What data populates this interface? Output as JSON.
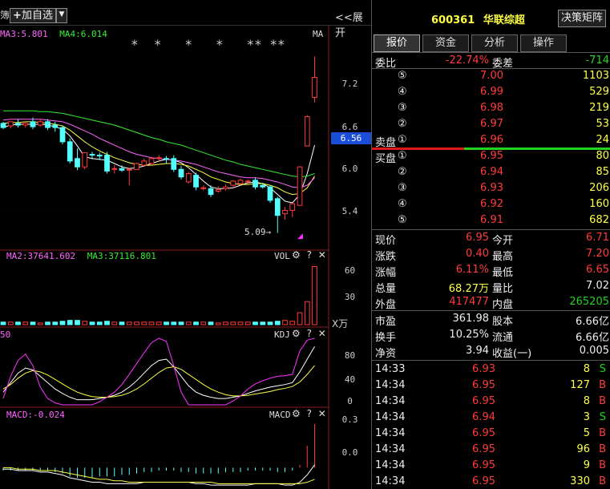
{
  "toolbar": {
    "left_cut": "簿",
    "add_label": "加自选",
    "expand_label": "展开",
    "expand_arrows": "<<"
  },
  "main_chart": {
    "ma_labels": [
      {
        "text": "MA3:5.801",
        "color": "#ff66ff"
      },
      {
        "text": "MA4:6.014",
        "color": "#33ee33"
      }
    ],
    "ma_tag": "MA",
    "stars": "*  *   *   *   ** **",
    "y_ticks": [
      "7.2",
      "6.6",
      "6.0",
      "5.4"
    ],
    "current_price": "6.56",
    "low_label": "5.09",
    "low_arrow": "→"
  },
  "vol_pane": {
    "labels": [
      {
        "text": "MA2:37641.602",
        "color": "#ff66ff"
      },
      {
        "text": "MA3:37116.801",
        "color": "#33ee33"
      }
    ],
    "name": "VOL",
    "y_ticks": [
      "60",
      "30"
    ],
    "unit": "X万"
  },
  "kdj_pane": {
    "left_value": "50",
    "name": "KDJ",
    "y_ticks": [
      "80",
      "40",
      "0"
    ]
  },
  "macd_pane": {
    "label": "MACD:-0.024",
    "name": "MACD",
    "y_ticks": [
      "0.3",
      "0.0"
    ]
  },
  "controls": {
    "gear": "⚙",
    "help": "?",
    "close": "✕"
  },
  "header": {
    "code": "600361",
    "name": "华联综超",
    "matrix_button": "决策矩阵"
  },
  "tabs": [
    "报价",
    "资金",
    "分析",
    "操作"
  ],
  "wei": {
    "ratio_label": "委比",
    "ratio_value": "-22.74%",
    "diff_label": "委差",
    "diff_value": "-714"
  },
  "sell": [
    {
      "label": "",
      "num": "⑤",
      "price": "7.00",
      "vol": "1103"
    },
    {
      "label": "",
      "num": "④",
      "price": "6.99",
      "vol": "529"
    },
    {
      "label": "",
      "num": "③",
      "price": "6.98",
      "vol": "219"
    },
    {
      "label": "",
      "num": "②",
      "price": "6.97",
      "vol": "53"
    },
    {
      "label": "卖盘",
      "num": "①",
      "price": "6.96",
      "vol": "24"
    }
  ],
  "buy": [
    {
      "label": "买盘",
      "num": "①",
      "price": "6.95",
      "vol": "80"
    },
    {
      "label": "",
      "num": "②",
      "price": "6.94",
      "vol": "85"
    },
    {
      "label": "",
      "num": "③",
      "price": "6.93",
      "vol": "206"
    },
    {
      "label": "",
      "num": "④",
      "price": "6.92",
      "vol": "160"
    },
    {
      "label": "",
      "num": "⑤",
      "price": "6.91",
      "vol": "682"
    }
  ],
  "stats": [
    {
      "l1": "现价",
      "v1": "6.95",
      "c1": "red",
      "l2": "今开",
      "v2": "6.71",
      "c2": "red"
    },
    {
      "l1": "涨跌",
      "v1": "0.40",
      "c1": "red",
      "l2": "最高",
      "v2": "7.20",
      "c2": "red"
    },
    {
      "l1": "涨幅",
      "v1": "6.11%",
      "c1": "red",
      "l2": "最低",
      "v2": "6.65",
      "c2": "red"
    },
    {
      "l1": "总量",
      "v1": "68.27万",
      "c1": "yellow",
      "l2": "量比",
      "v2": "7.02",
      "c2": "white"
    },
    {
      "l1": "外盘",
      "v1": "417477",
      "c1": "red",
      "l2": "内盘",
      "v2": "265205",
      "c2": "green"
    }
  ],
  "stats2": [
    {
      "l1": "市盈",
      "v1": "361.98",
      "l2": "股本",
      "v2": "6.66亿"
    },
    {
      "l1": "换手",
      "v1": "10.25%",
      "l2": "流通",
      "v2": "6.66亿"
    },
    {
      "l1": "净资",
      "v1": "3.94",
      "l2": "收益(一)",
      "v2": "0.005"
    }
  ],
  "ticks": [
    {
      "time": "14:33",
      "price": "6.93",
      "vol": "8",
      "side": "S"
    },
    {
      "time": "14:34",
      "price": "6.95",
      "vol": "127",
      "side": "B"
    },
    {
      "time": "14:34",
      "price": "6.95",
      "vol": "8",
      "side": "B"
    },
    {
      "time": "14:34",
      "price": "6.94",
      "vol": "3",
      "side": "S"
    },
    {
      "time": "14:34",
      "price": "6.95",
      "vol": "5",
      "side": "B"
    },
    {
      "time": "14:34",
      "price": "6.95",
      "vol": "96",
      "side": "B"
    },
    {
      "time": "14:34",
      "price": "6.95",
      "vol": "9",
      "side": "B"
    },
    {
      "time": "14:34",
      "price": "6.95",
      "vol": "330",
      "side": "B"
    }
  ],
  "chart_data": {
    "type": "candlestick",
    "ylim": [
      5.0,
      7.3
    ],
    "candles": [
      {
        "o": 6.4,
        "h": 6.42,
        "c": 6.35,
        "l": 6.33
      },
      {
        "o": 6.37,
        "h": 6.4,
        "c": 6.42,
        "l": 6.34
      },
      {
        "o": 6.4,
        "h": 6.45,
        "c": 6.38,
        "l": 6.35
      },
      {
        "o": 6.38,
        "h": 6.42,
        "c": 6.4,
        "l": 6.35
      },
      {
        "o": 6.42,
        "h": 6.47,
        "c": 6.36,
        "l": 6.33
      },
      {
        "o": 6.38,
        "h": 6.45,
        "c": 6.42,
        "l": 6.36
      },
      {
        "o": 6.42,
        "h": 6.45,
        "c": 6.35,
        "l": 6.32
      },
      {
        "o": 6.38,
        "h": 6.42,
        "c": 6.35,
        "l": 6.3
      },
      {
        "o": 6.35,
        "h": 6.37,
        "c": 6.18,
        "l": 6.15
      },
      {
        "o": 6.18,
        "h": 6.22,
        "c": 5.95,
        "l": 5.92
      },
      {
        "o": 5.98,
        "h": 6.1,
        "c": 5.88,
        "l": 5.84
      },
      {
        "o": 5.88,
        "h": 5.97,
        "c": 6.05,
        "l": 5.85
      },
      {
        "o": 6.03,
        "h": 6.06,
        "c": 6.02,
        "l": 5.97
      },
      {
        "o": 6.02,
        "h": 6.05,
        "c": 6.01,
        "l": 5.96
      },
      {
        "o": 6.02,
        "h": 6.06,
        "c": 5.83,
        "l": 5.8
      },
      {
        "o": 5.85,
        "h": 5.9,
        "c": 5.86,
        "l": 5.8
      },
      {
        "o": 5.86,
        "h": 5.9,
        "c": 5.84,
        "l": 5.82
      },
      {
        "o": 5.85,
        "h": 5.87,
        "c": 5.85,
        "l": 5.66
      },
      {
        "o": 5.85,
        "h": 5.93,
        "c": 5.92,
        "l": 5.85
      },
      {
        "o": 5.9,
        "h": 5.98,
        "c": 5.95,
        "l": 5.88
      },
      {
        "o": 5.92,
        "h": 6.0,
        "c": 5.98,
        "l": 5.9
      },
      {
        "o": 5.98,
        "h": 6.02,
        "c": 5.99,
        "l": 5.94
      },
      {
        "o": 5.98,
        "h": 6.01,
        "c": 5.97,
        "l": 5.92
      },
      {
        "o": 5.98,
        "h": 6.02,
        "c": 5.85,
        "l": 5.82
      },
      {
        "o": 5.85,
        "h": 5.89,
        "c": 5.76,
        "l": 5.73
      },
      {
        "o": 5.7,
        "h": 5.82,
        "c": 5.8,
        "l": 5.68
      },
      {
        "o": 5.78,
        "h": 5.81,
        "c": 5.64,
        "l": 5.6
      },
      {
        "o": 5.62,
        "h": 5.66,
        "c": 5.63,
        "l": 5.6
      },
      {
        "o": 5.62,
        "h": 5.66,
        "c": 5.55,
        "l": 5.52
      },
      {
        "o": 5.59,
        "h": 5.65,
        "c": 5.61,
        "l": 5.57
      },
      {
        "o": 5.62,
        "h": 5.67,
        "c": 5.64,
        "l": 5.6
      },
      {
        "o": 5.66,
        "h": 5.72,
        "c": 5.71,
        "l": 5.64
      },
      {
        "o": 5.68,
        "h": 5.74,
        "c": 5.72,
        "l": 5.66
      },
      {
        "o": 5.7,
        "h": 5.73,
        "c": 5.71,
        "l": 5.68
      },
      {
        "o": 5.72,
        "h": 5.75,
        "c": 5.64,
        "l": 5.61
      },
      {
        "o": 5.66,
        "h": 5.69,
        "c": 5.64,
        "l": 5.62
      },
      {
        "o": 5.64,
        "h": 5.66,
        "c": 5.48,
        "l": 5.45
      },
      {
        "o": 5.5,
        "h": 5.52,
        "c": 5.3,
        "l": 5.09
      },
      {
        "o": 5.32,
        "h": 5.4,
        "c": 5.36,
        "l": 5.25
      },
      {
        "o": 5.36,
        "h": 5.45,
        "c": 5.44,
        "l": 5.28
      },
      {
        "o": 5.42,
        "h": 5.89,
        "c": 5.88,
        "l": 5.42
      },
      {
        "o": 6.13,
        "h": 6.5,
        "c": 6.48,
        "l": 6.13
      },
      {
        "o": 6.71,
        "h": 7.2,
        "c": 6.95,
        "l": 6.65
      }
    ],
    "ma_series": [
      {
        "color": "#ffffff",
        "values": [
          6.35,
          6.38,
          6.39,
          6.39,
          6.39,
          6.39,
          6.38,
          6.36,
          6.33,
          6.25,
          6.13,
          6.0,
          5.98,
          5.97,
          5.96,
          5.92,
          5.88,
          5.86,
          5.87,
          5.89,
          5.92,
          5.95,
          5.97,
          5.96,
          5.93,
          5.87,
          5.79,
          5.71,
          5.64,
          5.62,
          5.62,
          5.63,
          5.66,
          5.69,
          5.7,
          5.68,
          5.63,
          5.55,
          5.47,
          5.45,
          5.55,
          5.8,
          6.14
        ]
      },
      {
        "color": "#ffff44",
        "values": [
          6.4,
          6.41,
          6.41,
          6.42,
          6.42,
          6.41,
          6.4,
          6.39,
          6.37,
          6.32,
          6.25,
          6.18,
          6.12,
          6.07,
          6.03,
          5.99,
          5.96,
          5.93,
          5.91,
          5.9,
          5.9,
          5.91,
          5.92,
          5.92,
          5.91,
          5.89,
          5.85,
          5.81,
          5.76,
          5.73,
          5.7,
          5.68,
          5.67,
          5.67,
          5.68,
          5.68,
          5.66,
          5.63,
          5.58,
          5.55,
          5.56,
          5.63,
          5.77
        ]
      },
      {
        "color": "#ff66ff",
        "values": [
          6.44,
          6.45,
          6.45,
          6.45,
          6.45,
          6.45,
          6.44,
          6.43,
          6.42,
          6.39,
          6.35,
          6.31,
          6.27,
          6.22,
          6.18,
          6.14,
          6.1,
          6.06,
          6.03,
          6.01,
          5.99,
          5.98,
          5.97,
          5.96,
          5.95,
          5.93,
          5.91,
          5.88,
          5.85,
          5.82,
          5.8,
          5.78,
          5.76,
          5.75,
          5.75,
          5.74,
          5.72,
          5.7,
          5.67,
          5.64,
          5.63,
          5.66,
          5.75
        ]
      },
      {
        "color": "#33ee33",
        "values": [
          6.55,
          6.55,
          6.55,
          6.55,
          6.55,
          6.54,
          6.54,
          6.53,
          6.52,
          6.5,
          6.48,
          6.46,
          6.44,
          6.42,
          6.4,
          6.38,
          6.35,
          6.32,
          6.29,
          6.26,
          6.23,
          6.21,
          6.18,
          6.16,
          6.14,
          6.11,
          6.08,
          6.05,
          6.02,
          5.99,
          5.96,
          5.94,
          5.91,
          5.89,
          5.87,
          5.85,
          5.83,
          5.81,
          5.79,
          5.77,
          5.76,
          5.77,
          5.8
        ]
      }
    ],
    "volume": {
      "ylim": [
        0,
        75
      ],
      "values": [
        3,
        3,
        3,
        3,
        3,
        2,
        3,
        3,
        4,
        5,
        5,
        4,
        3,
        3,
        4,
        3,
        3,
        3,
        3,
        3,
        3,
        3,
        3,
        3,
        3,
        3,
        3,
        3,
        3,
        2,
        3,
        3,
        3,
        3,
        3,
        3,
        3,
        4,
        5,
        4,
        14,
        27,
        68
      ]
    },
    "kdj": {
      "ylim": [
        0,
        110
      ],
      "k": [
        20,
        35,
        50,
        58,
        55,
        45,
        35,
        25,
        18,
        12,
        8,
        8,
        8,
        10,
        12,
        15,
        20,
        28,
        38,
        50,
        62,
        70,
        72,
        60,
        45,
        30,
        20,
        15,
        12,
        10,
        10,
        12,
        14,
        18,
        22,
        25,
        28,
        30,
        32,
        35,
        52,
        72,
        92
      ],
      "d": [
        25,
        32,
        42,
        50,
        54,
        52,
        47,
        40,
        33,
        26,
        20,
        16,
        13,
        12,
        12,
        13,
        15,
        19,
        25,
        33,
        42,
        51,
        58,
        60,
        56,
        48,
        40,
        32,
        25,
        20,
        16,
        14,
        14,
        15,
        17,
        19,
        21,
        24,
        26,
        29,
        36,
        48,
        62
      ],
      "j": [
        10,
        45,
        70,
        80,
        62,
        28,
        10,
        3,
        0,
        0,
        0,
        0,
        0,
        5,
        12,
        20,
        32,
        48,
        65,
        82,
        98,
        105,
        100,
        62,
        20,
        0,
        0,
        0,
        0,
        0,
        0,
        6,
        14,
        25,
        33,
        38,
        42,
        45,
        46,
        48,
        85,
        102,
        105
      ]
    },
    "macd": {
      "ylim": [
        -0.13,
        0.36
      ],
      "hist": [
        -0.02,
        -0.02,
        -0.02,
        -0.02,
        -0.02,
        -0.02,
        -0.02,
        -0.03,
        -0.04,
        -0.06,
        -0.07,
        -0.07,
        -0.07,
        -0.06,
        -0.06,
        -0.06,
        -0.05,
        -0.05,
        -0.04,
        -0.03,
        -0.03,
        -0.02,
        -0.02,
        -0.02,
        -0.03,
        -0.03,
        -0.04,
        -0.04,
        -0.04,
        -0.04,
        -0.03,
        -0.03,
        -0.03,
        -0.02,
        -0.02,
        -0.02,
        -0.02,
        -0.03,
        -0.03,
        -0.02,
        0.02,
        0.15,
        0.3
      ],
      "dif": [
        -0.01,
        -0.01,
        -0.02,
        -0.02,
        -0.02,
        -0.03,
        -0.03,
        -0.04,
        -0.05,
        -0.07,
        -0.08,
        -0.09,
        -0.1,
        -0.1,
        -0.11,
        -0.11,
        -0.11,
        -0.11,
        -0.11,
        -0.1,
        -0.1,
        -0.1,
        -0.1,
        -0.1,
        -0.1,
        -0.1,
        -0.11,
        -0.11,
        -0.12,
        -0.12,
        -0.12,
        -0.12,
        -0.12,
        -0.12,
        -0.11,
        -0.11,
        -0.11,
        -0.11,
        -0.12,
        -0.12,
        -0.1,
        -0.05,
        0.02
      ],
      "dea": [
        0.0,
        0.0,
        -0.01,
        -0.01,
        -0.01,
        -0.02,
        -0.02,
        -0.02,
        -0.03,
        -0.04,
        -0.05,
        -0.06,
        -0.07,
        -0.08,
        -0.08,
        -0.09,
        -0.09,
        -0.1,
        -0.1,
        -0.1,
        -0.1,
        -0.1,
        -0.1,
        -0.1,
        -0.1,
        -0.1,
        -0.1,
        -0.1,
        -0.1,
        -0.11,
        -0.11,
        -0.11,
        -0.11,
        -0.11,
        -0.11,
        -0.11,
        -0.11,
        -0.11,
        -0.11,
        -0.11,
        -0.11,
        -0.1,
        -0.08
      ]
    }
  }
}
